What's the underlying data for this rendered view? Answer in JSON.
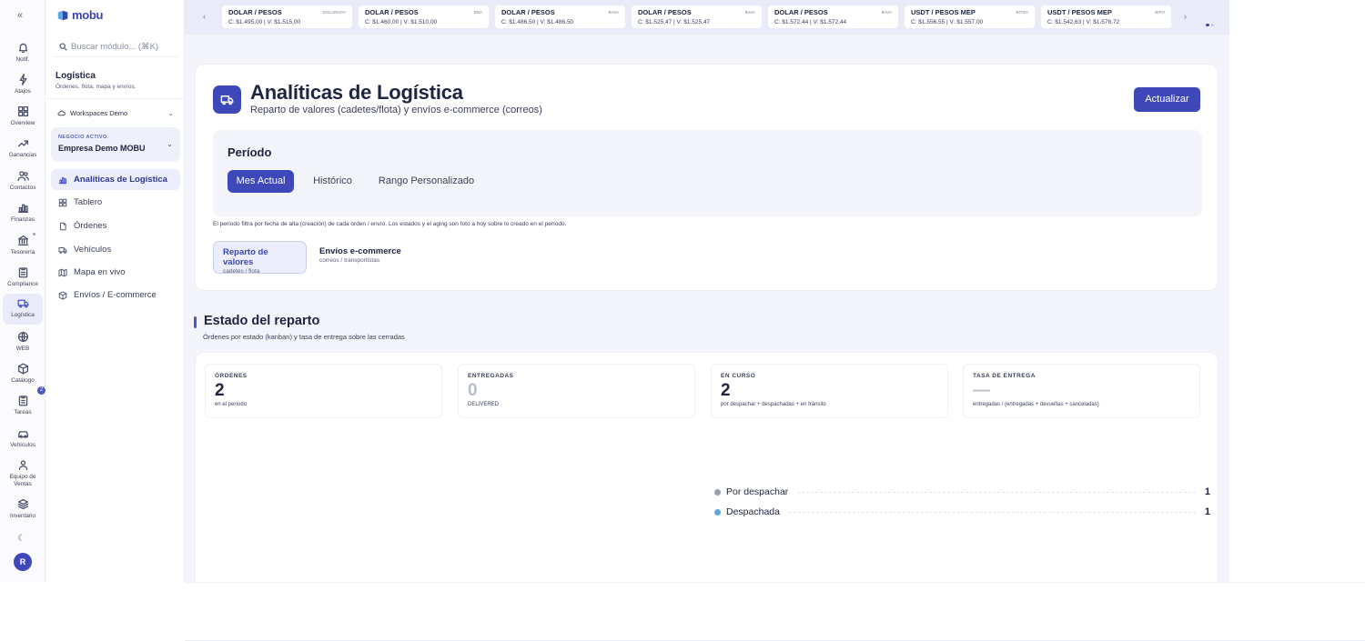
{
  "brand": {
    "name": "mobu",
    "color": "#3f48b8"
  },
  "rail": {
    "items": [
      {
        "label": "Notif.",
        "icon": "bell-icon"
      },
      {
        "label": "Atajos",
        "icon": "lightning-icon"
      },
      {
        "label": "Overview",
        "icon": "grid-icon"
      },
      {
        "label": "Ganancias",
        "icon": "trending-up-icon"
      },
      {
        "label": "Contactos",
        "icon": "users-icon"
      },
      {
        "label": "Finanzas",
        "icon": "bar-chart-icon"
      },
      {
        "label": "Tesorería",
        "icon": "bank-icon"
      },
      {
        "label": "Compliance",
        "icon": "clipboard-icon"
      },
      {
        "label": "Logística",
        "icon": "truck-icon",
        "active": true
      },
      {
        "label": "WEB",
        "icon": "globe-icon"
      },
      {
        "label": "Catálogo",
        "icon": "box-icon"
      },
      {
        "label": "Tareas",
        "icon": "clipboard-list-icon"
      },
      {
        "label": "Vehículos",
        "icon": "car-icon"
      },
      {
        "label": "Equipo de Ventas",
        "icon": "team-icon"
      },
      {
        "label": "Inventario",
        "icon": "layers-icon"
      }
    ],
    "catalog_badge": "2",
    "avatar": "R"
  },
  "sidebar": {
    "search_placeholder": "Buscar módulo... (⌘K)",
    "title": "Logística",
    "subtitle": "Órdenes, flota, mapa y envíos.",
    "workspace": "Workspaces Demo",
    "business_key": "NEGOCIO ACTIVO",
    "business_value": "Empresa Demo MOBU",
    "items": [
      {
        "label": "Analíticas de Logística",
        "icon": "bar-chart-icon",
        "active": true
      },
      {
        "label": "Tablero",
        "icon": "grid-icon"
      },
      {
        "label": "Órdenes",
        "icon": "document-icon"
      },
      {
        "label": "Vehículos",
        "icon": "truck-icon"
      },
      {
        "label": "Mapa en vivo",
        "icon": "map-icon"
      },
      {
        "label": "Envíos / E-commerce",
        "icon": "package-icon"
      }
    ]
  },
  "ticker": [
    {
      "name": "DOLAR / PESOS",
      "tag": "DOLARHOY",
      "c": "C: $1.495,00",
      "v": "V: $1.515,00"
    },
    {
      "name": "DOLAR / PESOS",
      "tag": "BNA",
      "c": "C: $1.460,00",
      "v": "V: $1.510,00"
    },
    {
      "name": "DOLAR / PESOS",
      "tag": "BAVA",
      "c": "C: $1.486,50",
      "v": "V: $1.486,50"
    },
    {
      "name": "DOLAR / PESOS",
      "tag": "BAVA",
      "c": "C: $1.525,47",
      "v": "V: $1.525,47"
    },
    {
      "name": "DOLAR / PESOS",
      "tag": "BAVA",
      "c": "C: $1.572,44",
      "v": "V: $1.572,44"
    },
    {
      "name": "USDT / PESOS MEP",
      "tag": "BITSO",
      "c": "C: $1.556,55",
      "v": "V: $1.557,00"
    },
    {
      "name": "USDT / PESOS MEP",
      "tag": "BIPO",
      "c": "C: $1.542,63",
      "v": "V: $1.578,72"
    }
  ],
  "header": {
    "title": "Analíticas de Logística",
    "subtitle": "Reparto de valores (cadetes/flota) y envíos e-commerce (correos)",
    "refresh_label": "Actualizar"
  },
  "period": {
    "title": "Período",
    "options": [
      {
        "label": "Mes Actual",
        "active": true
      },
      {
        "label": "Histórico"
      },
      {
        "label": "Rango Personalizado"
      }
    ],
    "note": "El período filtra por fecha de alta (creación) de cada orden / envío. Los estados y el aging son foto a hoy sobre lo creado en el período."
  },
  "segments": [
    {
      "title": "Reparto de valores",
      "sub": "cadetes / flota",
      "active": true
    },
    {
      "title": "Envíos e-commerce",
      "sub": "correos / transportistas"
    }
  ],
  "section": {
    "title": "Estado del reparto",
    "subtitle": "Órdenes por estado (kanban) y tasa de entrega sobre las cerradas"
  },
  "kpis": [
    {
      "key": "ÓRDENES",
      "value": "2",
      "sub": "en el período"
    },
    {
      "key": "ENTREGADAS",
      "value": "0",
      "sub": "DELIVERED",
      "muted": true
    },
    {
      "key": "EN CURSO",
      "value": "2",
      "sub": "por despachar + despachadas + en tránsito"
    },
    {
      "key": "TASA DE ENTREGA",
      "value": "—",
      "sub": "entregadas / (entregadas + devueltas + canceladas)",
      "muted": true
    }
  ],
  "status_list": [
    {
      "label": "Por despachar",
      "value": "1",
      "color": "#9aa0b4"
    },
    {
      "label": "Despachada",
      "value": "1",
      "color": "#5aa7d8"
    }
  ]
}
